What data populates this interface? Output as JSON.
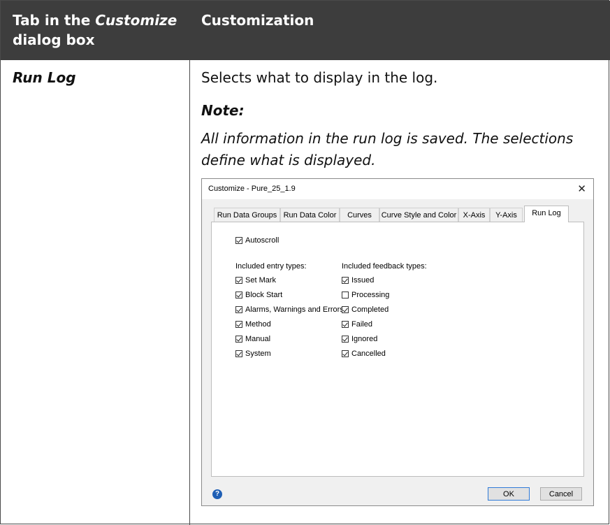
{
  "table": {
    "header_col1_prefix": "Tab in the ",
    "header_col1_em": "Customize",
    "header_col1_suffix": "dialog box",
    "header_col2": "Customization",
    "row_label": "Run Log",
    "description": "Selects what to display in the log.",
    "note_heading": "Note:",
    "note_body": "All information in the run log is saved. The selections define what is displayed."
  },
  "dialog": {
    "title": "Customize - Pure_25_1.9",
    "close_glyph": "✕",
    "tabs": [
      "Run Data Groups",
      "Run Data Color",
      "Curves",
      "Curve Style and Color",
      "X-Axis",
      "Y-Axis",
      "Run Log"
    ],
    "active_tab": "Run Log",
    "autoscroll": {
      "label": "Autoscroll",
      "checked": true
    },
    "entry_types_label": "Included entry types:",
    "entry_types": [
      {
        "label": "Set Mark",
        "checked": true
      },
      {
        "label": "Block Start",
        "checked": true
      },
      {
        "label": "Alarms, Warnings and Errors",
        "checked": true
      },
      {
        "label": "Method",
        "checked": true
      },
      {
        "label": "Manual",
        "checked": true
      },
      {
        "label": "System",
        "checked": true
      }
    ],
    "feedback_types_label": "Included feedback types:",
    "feedback_types": [
      {
        "label": "Issued",
        "checked": true
      },
      {
        "label": "Processing",
        "checked": false
      },
      {
        "label": "Completed",
        "checked": true
      },
      {
        "label": "Failed",
        "checked": true
      },
      {
        "label": "Ignored",
        "checked": true
      },
      {
        "label": "Cancelled",
        "checked": true
      }
    ],
    "help_glyph": "?",
    "ok_label": "OK",
    "cancel_label": "Cancel"
  }
}
